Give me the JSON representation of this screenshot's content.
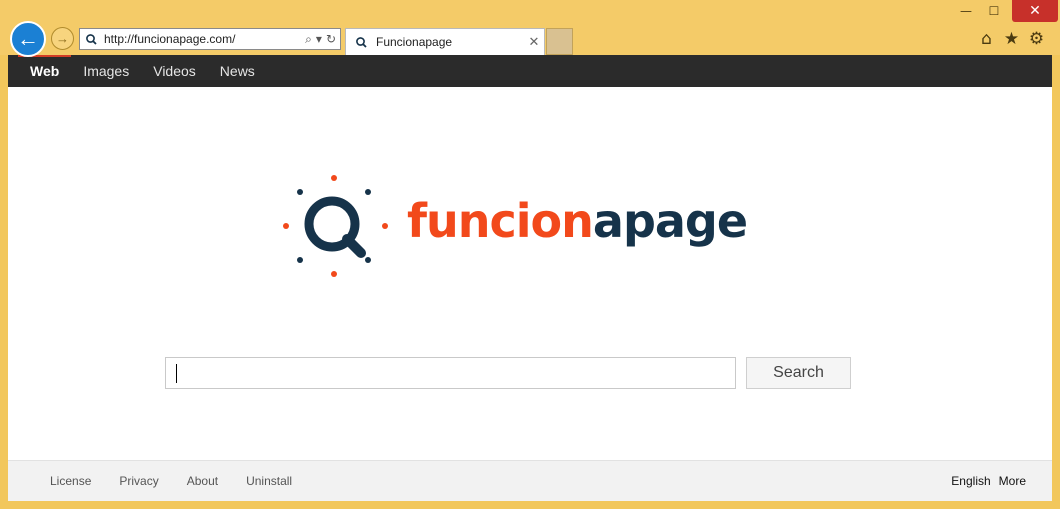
{
  "window": {
    "minimize_glyph": "—",
    "maximize_glyph": "☐",
    "close_glyph": "✕"
  },
  "nav_buttons": {
    "back_icon": "←",
    "forward_icon": "→"
  },
  "address_bar": {
    "url": "http://funcionapage.com/",
    "search_icon": "⌕",
    "dropdown_icon": "▾",
    "refresh_icon": "↻"
  },
  "tab": {
    "title": "Funcionapage",
    "close_icon": "✕"
  },
  "toolbar": {
    "home_icon": "⌂",
    "favorites_icon": "★",
    "settings_icon": "⚙"
  },
  "top_nav": {
    "items": [
      "Web",
      "Images",
      "Videos",
      "News"
    ],
    "active": "Web"
  },
  "logo": {
    "part1": "funcion",
    "part2": "apage",
    "orange": "#f2491b",
    "dark": "#16334a"
  },
  "search": {
    "value": "",
    "button_label": "Search"
  },
  "footer": {
    "links": [
      "License",
      "Privacy",
      "About",
      "Uninstall"
    ],
    "language": "English",
    "more": "More"
  },
  "colors": {
    "frame": "#f4cb68",
    "back_button": "#1b80d4",
    "close_button": "#c7302a",
    "nav_bar": "#2b2b2b",
    "nav_active_underline": "#d33d26"
  }
}
